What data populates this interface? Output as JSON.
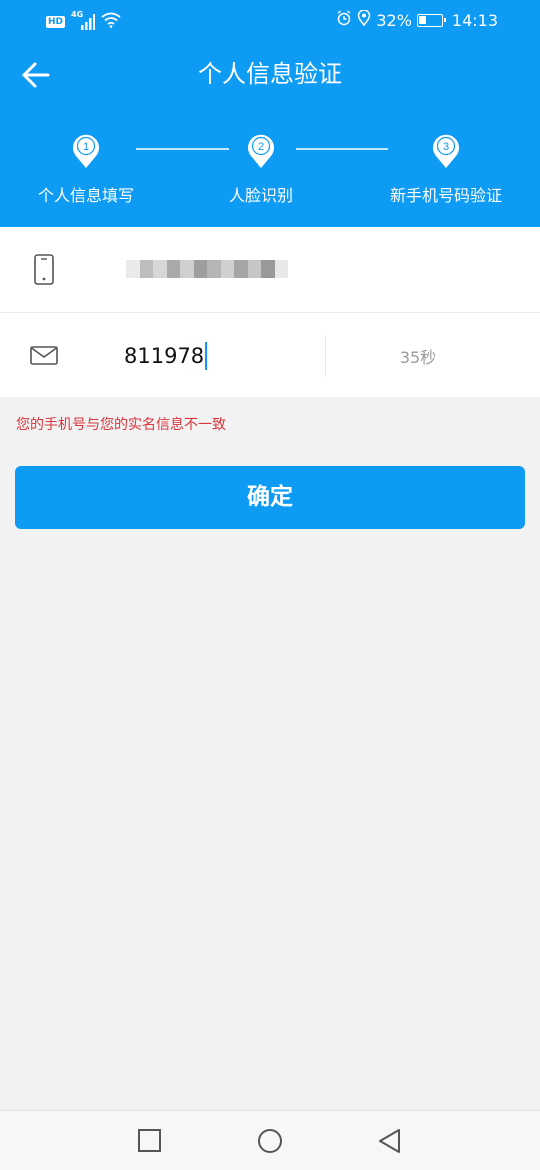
{
  "status_bar": {
    "network_badge": "HD",
    "network_type": "4G",
    "battery_percent": "32%",
    "battery_level": 0.32,
    "time": "14:13",
    "icons": [
      "hd-icon",
      "signal-icon",
      "wifi-icon",
      "alarm-icon",
      "location-icon",
      "battery-icon"
    ]
  },
  "header": {
    "title": "个人信息验证",
    "back_icon": "back-arrow-icon",
    "background_color": "#0d9bf3"
  },
  "steps": [
    {
      "number": "1",
      "label": "个人信息填写"
    },
    {
      "number": "2",
      "label": "人脸识别"
    },
    {
      "number": "3",
      "label": "新手机号码验证"
    }
  ],
  "form": {
    "phone_icon": "phone-icon",
    "phone_value_masked": true,
    "code_icon": "envelope-icon",
    "code_value": "811978",
    "countdown": "35秒"
  },
  "error_message": "您的手机号与您的实名信息不一致",
  "error_color": "#d9363e",
  "confirm_button": "确定",
  "nav_bar": {
    "icons": [
      "recent-apps-icon",
      "home-icon",
      "back-icon"
    ]
  }
}
